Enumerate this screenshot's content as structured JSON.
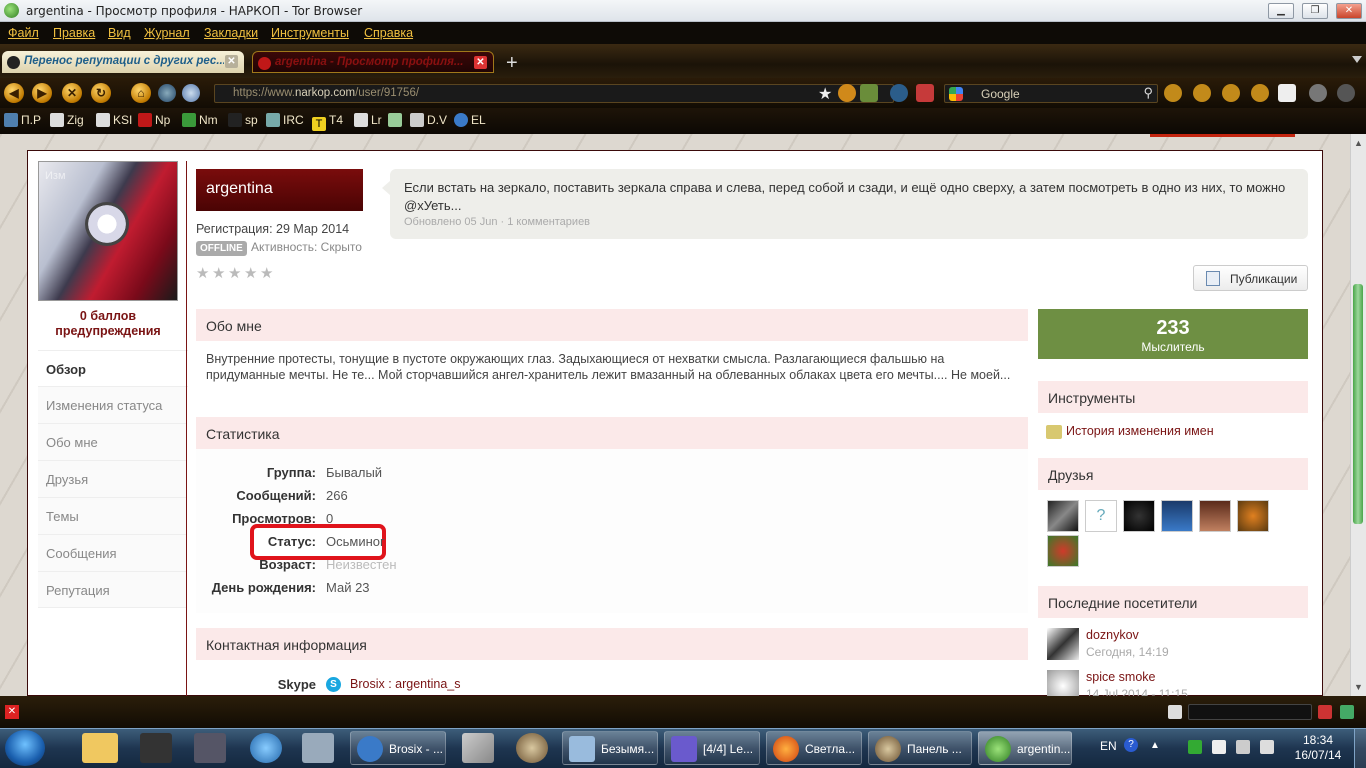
{
  "window": {
    "title": "argentina - Просмотр профиля - НАРКОП - Tor Browser",
    "minimize": "▁",
    "restore": "❐",
    "close": "✕"
  },
  "menu": [
    "Файл",
    "Правка",
    "Вид",
    "Журнал",
    "Закладки",
    "Инструменты",
    "Справка"
  ],
  "tabs": [
    {
      "label": "Перенос репутации с других рес..."
    },
    {
      "label": "argentina - Просмотр профиля..."
    }
  ],
  "nav": {
    "url_prefix": "https://www.",
    "url_domain": "narkop.com",
    "url_path": "/user/91756/",
    "search_engine": "Google"
  },
  "bookmarks": [
    "П.Р",
    "Zig",
    "KSI",
    "Np",
    "Nm",
    "sp",
    "IRC",
    "T4",
    "Lr",
    "D.V",
    "EL"
  ],
  "bookmark_icon_letters": {
    "t4": "T"
  },
  "profile": {
    "avatar_overlay": "Изм",
    "warning_points": "0 баллов",
    "warning_label": "предупреждения",
    "username": "argentina",
    "registration": "Регистрация: 29 Мар 2014",
    "offline_badge": "OFFLINE",
    "activity": "Активность: Скрыто",
    "rating_stars": 5,
    "status_update": "Если встать на зеркало, поставить зеркала справа и слева, перед собой и сзади, и ещё одно сверху, а затем посмотреть в одно из них, то можно @хУеть...",
    "status_meta": "Обновлено 05 Jun · 1 комментариев",
    "publications_button": "Публикации"
  },
  "sidebar": [
    {
      "label": "Обзор",
      "active": true
    },
    {
      "label": "Изменения статуса"
    },
    {
      "label": "Обо мне"
    },
    {
      "label": "Друзья"
    },
    {
      "label": "Темы"
    },
    {
      "label": "Сообщения"
    },
    {
      "label": "Репутация"
    }
  ],
  "about": {
    "title": "Обо мне",
    "text": "Внутренние протесты, тонущие в пустоте окружающих глаз. Задыхающиеся от нехватки смысла. Разлагающиеся фальшью на придуманные мечты. Не те... Мой сторчавшийся ангел-хранитель лежит вмазанный на облеванных облаках цвета его мечты.... Не моей..."
  },
  "stats": {
    "title": "Статистика",
    "rows": [
      {
        "label": "Группа:",
        "value": "Бывалый"
      },
      {
        "label": "Сообщений:",
        "value": "266"
      },
      {
        "label": "Просмотров:",
        "value": "0"
      },
      {
        "label": "Статус:",
        "value": "Осьминог"
      },
      {
        "label": "Возраст:",
        "value": "Неизвестен"
      },
      {
        "label": "День рождения:",
        "value": "Май 23"
      }
    ]
  },
  "contact": {
    "title": "Контактная информация",
    "skype_label": "Skype",
    "skype_value": "Brosix : argentina_s"
  },
  "reputation": {
    "value": "233",
    "rank": "Мыслитель"
  },
  "tools": {
    "title": "Инструменты",
    "link": "История изменения имен"
  },
  "friends": {
    "title": "Друзья"
  },
  "visitors": {
    "title": "Последние посетители",
    "items": [
      {
        "name": "doznykov",
        "time": "Сегодня, 14:19"
      },
      {
        "name": "spice smoke",
        "time": "14 Jul 2014 - 11:15"
      }
    ]
  },
  "taskbar": {
    "items": [
      "Brosix - ...",
      "Безымя...",
      "[4/4] Le...",
      "Светла...",
      "Панель ...",
      "argentin..."
    ],
    "lang": "EN",
    "time": "18:34",
    "date": "16/07/14"
  },
  "colors": {
    "accent": "#6b0a0a",
    "green": "#6e8f43",
    "link": "#7a1414"
  }
}
